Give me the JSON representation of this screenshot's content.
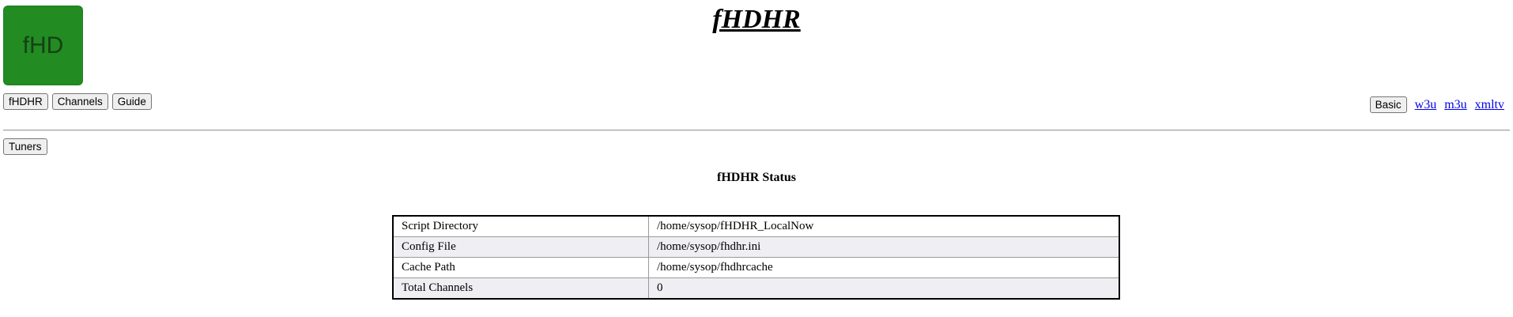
{
  "header": {
    "logo_text": "fHD",
    "title": "fHDHR"
  },
  "nav": {
    "left_buttons": [
      "fHDHR",
      "Channels",
      "Guide"
    ],
    "right_button": "Basic",
    "right_links": [
      "w3u",
      "m3u",
      "xmltv"
    ]
  },
  "subnav": {
    "tuners_label": "Tuners"
  },
  "status": {
    "title": "fHDHR Status",
    "rows": [
      {
        "key": "Script Directory",
        "value": "/home/sysop/fHDHR_LocalNow"
      },
      {
        "key": "Config File",
        "value": "/home/sysop/fhdhr.ini"
      },
      {
        "key": "Cache Path",
        "value": "/home/sysop/fhdhrcache"
      },
      {
        "key": "Total Channels",
        "value": "0"
      }
    ]
  },
  "colors": {
    "logo_bg": "#228b22",
    "link": "#0000ee",
    "row_alt": "#efeff3"
  }
}
